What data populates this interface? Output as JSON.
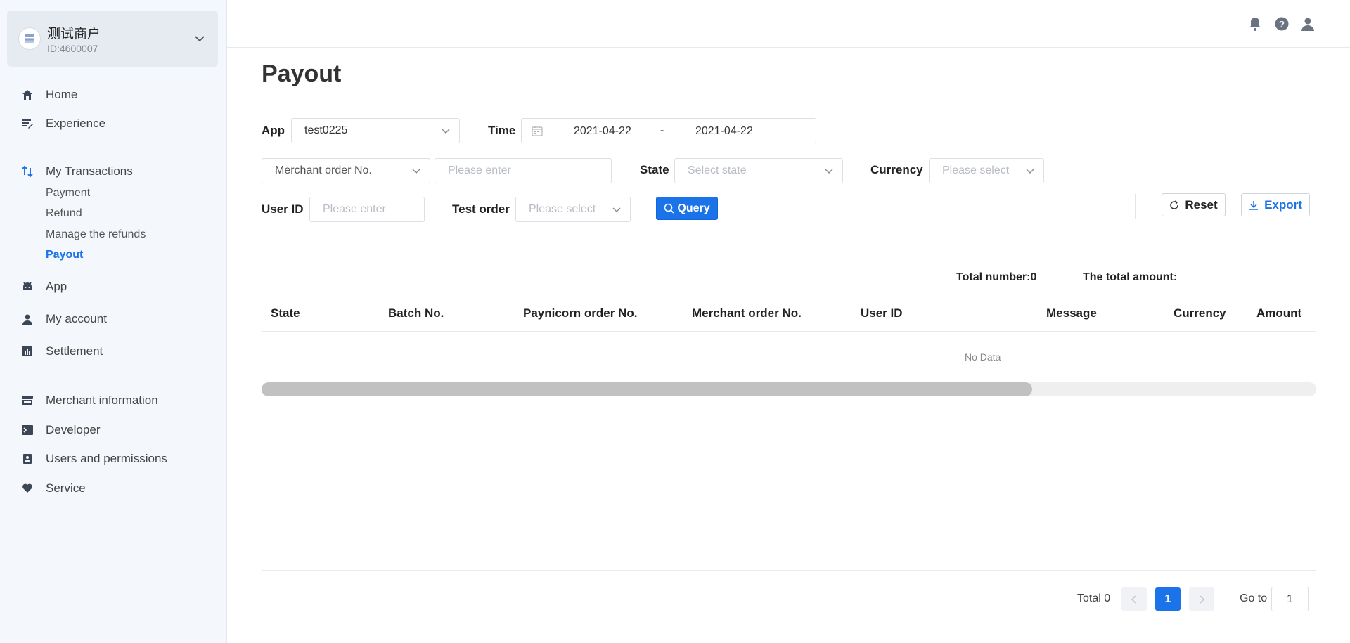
{
  "merchant": {
    "name": "测试商户",
    "id": "ID:4600007"
  },
  "sidebar": {
    "items": [
      {
        "label": "Home",
        "icon": "home-icon"
      },
      {
        "label": "Experience",
        "icon": "experience-icon"
      },
      {
        "label": "My Transactions",
        "icon": "transfer-icon"
      },
      {
        "label": "App",
        "icon": "android-icon"
      },
      {
        "label": "My account",
        "icon": "user-icon"
      },
      {
        "label": "Settlement",
        "icon": "bar-chart-icon"
      },
      {
        "label": "Merchant information",
        "icon": "store-icon"
      },
      {
        "label": "Developer",
        "icon": "terminal-icon"
      },
      {
        "label": "Users and permissions",
        "icon": "contacts-icon"
      },
      {
        "label": "Service",
        "icon": "heart-icon"
      }
    ],
    "sub_items": [
      "Payment",
      "Refund",
      "Manage the refunds",
      "Payout"
    ],
    "active_sub": "Payout"
  },
  "page": {
    "title": "Payout"
  },
  "filters": {
    "app_label": "App",
    "app_value": "test0225",
    "time_label": "Time",
    "date_start": "2021-04-22",
    "date_sep": "-",
    "date_end": "2021-04-22",
    "order_type_value": "Merchant order No.",
    "order_input_placeholder": "Please enter",
    "state_label": "State",
    "state_placeholder": "Select state",
    "currency_label": "Currency",
    "currency_placeholder": "Please select",
    "user_id_label": "User ID",
    "user_id_placeholder": "Please enter",
    "test_order_label": "Test order",
    "test_order_placeholder": "Please select"
  },
  "actions": {
    "query": "Query",
    "reset": "Reset",
    "export": "Export"
  },
  "summary": {
    "total_number": "Total number:0",
    "total_amount": "The total amount:"
  },
  "table": {
    "columns": [
      "State",
      "Batch No.",
      "Paynicorn order No.",
      "Merchant order No.",
      "User ID",
      "Message",
      "Currency",
      "Amount"
    ],
    "rows": [],
    "empty_text": "No Data"
  },
  "pagination": {
    "total": "Total 0",
    "current_page": "1",
    "goto_label": "Go to",
    "goto_value": "1"
  },
  "colors": {
    "accent": "#1a73e8",
    "sidebar_bg": "#f4f7fb"
  }
}
